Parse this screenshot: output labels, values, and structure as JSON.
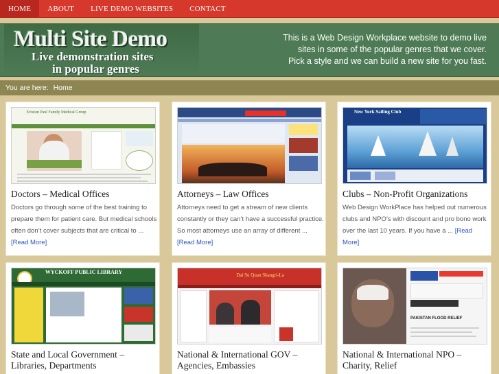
{
  "nav": {
    "items": [
      {
        "label": "HOME",
        "active": true
      },
      {
        "label": "ABOUT",
        "active": false
      },
      {
        "label": "LIVE DEMO WEBSITES",
        "active": false
      },
      {
        "label": "CONTACT",
        "active": false
      }
    ]
  },
  "header": {
    "title": "Multi Site Demo",
    "subtitle_line1": "Live demonstration sites",
    "subtitle_line2": "in popular genres",
    "tagline": "This is a Web Design Workplace website to demo live sites in some of the popular genres that we cover. Pick a style and we can build a new site for you fast."
  },
  "breadcrumb": {
    "prefix": "You are here:",
    "current": "Home"
  },
  "cards": [
    {
      "title": "Doctors – Medical Offices",
      "excerpt": "Doctors go through some of the best training to prepare them for patient care. But medical schools often don’t cover subjects that are critical to ...",
      "read_more": "[Read More]"
    },
    {
      "title": "Attorneys – Law Offices",
      "excerpt": "Attorneys need to get a stream of new clients constantly or they can’t have a successful practice. So most attorneys use an array of different ...",
      "read_more": "[Read More]"
    },
    {
      "title": "Clubs – Non-Profit Organizations",
      "excerpt": "Web Design WorkPlace has helped out numerous clubs and NPO’s with discount and pro bono work over the last 10 years. If you have a ...",
      "read_more": "[Read More]"
    },
    {
      "title": "State and Local Government – Libraries, Departments",
      "excerpt": "",
      "read_more": ""
    },
    {
      "title": "National & International GOV – Agencies, Embassies",
      "excerpt": "",
      "read_more": ""
    },
    {
      "title": "National & International NPO – Charity, Relief",
      "excerpt": "",
      "read_more": ""
    }
  ],
  "thumb_text": {
    "doctors_name": "Eviston Paul Family Medical Group",
    "sailing_club": "New York Sailing Club",
    "library": "WYCKOFF PUBLIC LIBRARY",
    "embassy": "Dai Su Quan Shangri-La",
    "relief": "PAKISTAN FLOOD RELIEF"
  },
  "colors": {
    "nav_red": "#d6382c",
    "header_green": "#4e7b55",
    "crumb_olive": "#8e8652",
    "page_tan": "#d8c89a",
    "link_blue": "#2a56c6"
  }
}
